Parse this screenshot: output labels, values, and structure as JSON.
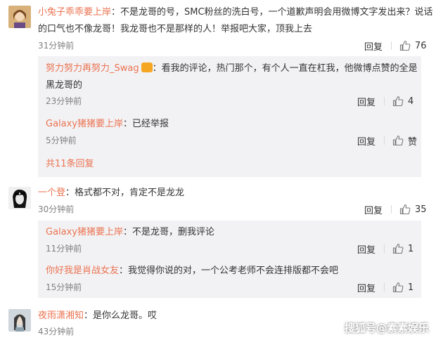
{
  "comments": [
    {
      "user": "小兔子乖乖要上岸",
      "line1": "：不是龙哥的号，SMC粉丝的洗白号，一个道歉声明会用微博文字发出来？说话",
      "line2": "的口气也不像龙哥！我龙哥也不是那样的人！举报吧大家，顶我上去",
      "time": "31分钟前",
      "reply_label": "回复",
      "likes": "76",
      "replies": [
        {
          "user": "努力努力再努力_Swag",
          "line1": "：看我的评论，热门那个，有个人一直在杠我，他微博点赞的全是",
          "line2": "黑龙哥的",
          "time": "23分钟前",
          "reply_label": "回复",
          "likes": "4"
        },
        {
          "user": "Galaxy猪猪要上岸",
          "line1": "：已经举报",
          "time": "5分钟前",
          "reply_label": "回复",
          "likes": "赞"
        }
      ],
      "more_label": "共11条回复"
    },
    {
      "user": "一个登",
      "line1": "：格式都不对，肯定不是龙龙",
      "time": "30分钟前",
      "reply_label": "回复",
      "likes": "35",
      "replies": [
        {
          "user": "Galaxy猪猪要上岸",
          "line1": "：不是龙哥，删我评论",
          "time": "11分钟前",
          "reply_label": "回复",
          "likes": "1"
        },
        {
          "user": "你好我是肖战女友",
          "line1": "：我觉得你说的对，一个公考老师不会连排版都不会吧",
          "time": "15分钟前",
          "reply_label": "回复",
          "likes": "1"
        }
      ]
    },
    {
      "user": "夜雨潇湘知",
      "line1": "：是你么龙哥。哎",
      "time": "43分钟前"
    }
  ],
  "watermark": "搜狐号@素素娱乐",
  "colors": {
    "username": "#eb7350",
    "subpanel": "#f2f2f5",
    "time": "#808080"
  }
}
